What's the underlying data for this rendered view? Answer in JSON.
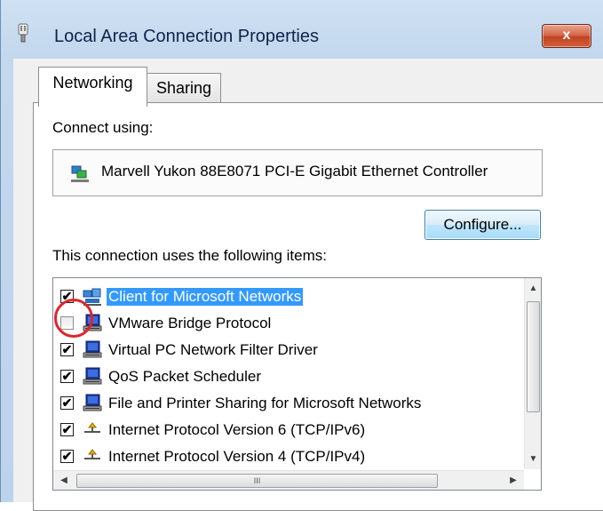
{
  "window": {
    "title": "Local Area Connection Properties",
    "close_label": "x"
  },
  "tabs": [
    {
      "label": "Networking",
      "active": true
    },
    {
      "label": "Sharing",
      "active": false
    }
  ],
  "connect_using_label": "Connect using:",
  "adapter": {
    "name": "Marvell Yukon 88E8071 PCI-E Gigabit Ethernet Controller",
    "icon": "network-adapter-icon"
  },
  "configure_label": "Configure...",
  "items_label": "This connection uses the following items:",
  "items": [
    {
      "label": "Client for Microsoft Networks",
      "checked": true,
      "selected": true,
      "icon": "client-network-icon"
    },
    {
      "label": "VMware Bridge Protocol",
      "checked": false,
      "selected": false,
      "icon": "network-service-icon"
    },
    {
      "label": "Virtual PC Network Filter Driver",
      "checked": true,
      "selected": false,
      "icon": "network-service-icon"
    },
    {
      "label": "QoS Packet Scheduler",
      "checked": true,
      "selected": false,
      "icon": "network-service-icon"
    },
    {
      "label": "File and Printer Sharing for Microsoft Networks",
      "checked": true,
      "selected": false,
      "icon": "network-service-icon"
    },
    {
      "label": "Internet Protocol Version 6 (TCP/IPv6)",
      "checked": true,
      "selected": false,
      "icon": "protocol-icon"
    },
    {
      "label": "Internet Protocol Version 4 (TCP/IPv4)",
      "checked": true,
      "selected": false,
      "icon": "protocol-icon"
    }
  ],
  "colors": {
    "selection": "#3399ff",
    "highlight_circle": "#e0242b",
    "close_button": "#c24423"
  }
}
